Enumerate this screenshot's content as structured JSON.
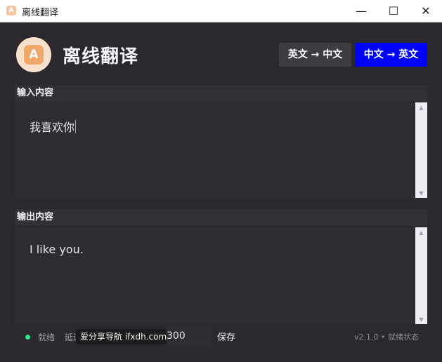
{
  "window": {
    "title": "离线翻译",
    "icon_letter": "A",
    "minimize_glyph": "—",
    "maximize_glyph": "☐",
    "close_glyph": "✕"
  },
  "header": {
    "logo_letter": "A",
    "title": "离线翻译",
    "modes": [
      {
        "label": "英文 → 中文",
        "active": false
      },
      {
        "label": "中文 → 英文",
        "active": true,
        "color": "#0000ff"
      }
    ]
  },
  "input": {
    "label": "输入内容",
    "text": "我喜欢你"
  },
  "output": {
    "label": "输出内容",
    "text": "I like you."
  },
  "scrollbar": {
    "up_glyph": "▲",
    "down_glyph": "▼"
  },
  "footer": {
    "status": "就绪",
    "status_color": "#2ee58a",
    "delay_label": "延迟",
    "watermark": "爱分享导航 ifxdh.com",
    "delay_value": "300",
    "save_label": "保存",
    "version": "v2.1.0 • 就绪状态"
  }
}
